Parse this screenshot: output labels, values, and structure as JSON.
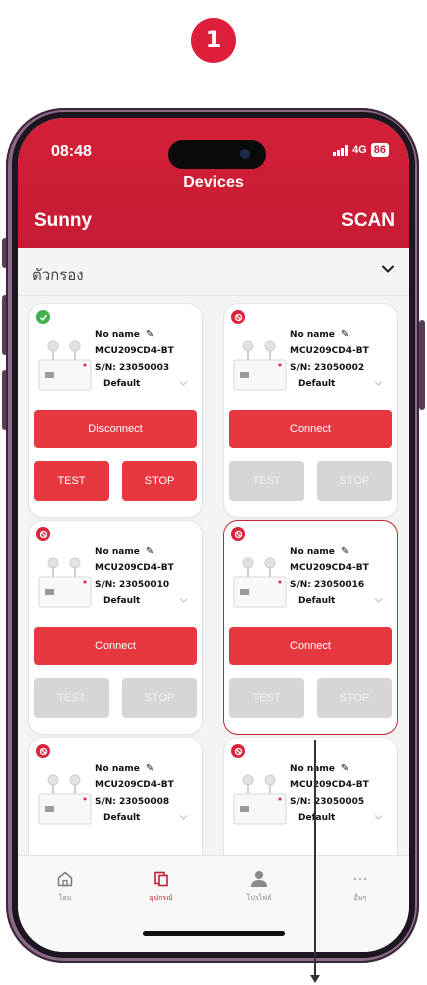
{
  "step_number": "1",
  "status_bar": {
    "time": "08:48",
    "network": "4G",
    "battery": "86"
  },
  "header": {
    "title": "Devices",
    "left_label": "Sunny",
    "right_action": "SCAN"
  },
  "filter": {
    "label": "ตัวกรอง"
  },
  "devices": [
    {
      "state": "connected",
      "name": "No name",
      "model": "MCU209CD4-BT",
      "serial": "S/N: 23050003",
      "mode": "Default",
      "action": "Disconnect",
      "test": "TEST",
      "stop": "STOP",
      "controls_enabled": true
    },
    {
      "state": "disconnected",
      "name": "No name",
      "model": "MCU209CD4-BT",
      "serial": "S/N: 23050002",
      "mode": "Default",
      "action": "Connect",
      "test": "TEST",
      "stop": "STOP",
      "controls_enabled": false
    },
    {
      "state": "disconnected",
      "name": "No name",
      "model": "MCU209CD4-BT",
      "serial": "S/N: 23050010",
      "mode": "Default",
      "action": "Connect",
      "test": "TEST",
      "stop": "STOP",
      "controls_enabled": false
    },
    {
      "state": "disconnected",
      "name": "No name",
      "model": "MCU209CD4-BT",
      "serial": "S/N: 23050016",
      "mode": "Default",
      "action": "Connect",
      "test": "TEST",
      "stop": "STOP",
      "controls_enabled": false,
      "highlighted": true
    },
    {
      "state": "disconnected",
      "name": "No name",
      "model": "MCU209CD4-BT",
      "serial": "S/N: 23050008",
      "mode": "Default"
    },
    {
      "state": "disconnected",
      "name": "No name",
      "model": "MCU209CD4-BT",
      "serial": "S/N: 23050005",
      "mode": "Default"
    }
  ],
  "tabbar": [
    {
      "label": "โฮม",
      "icon": "home-icon",
      "active": false
    },
    {
      "label": "อุปกรณ์",
      "icon": "devices-icon",
      "active": true
    },
    {
      "label": "โปรไฟล์",
      "icon": "profile-icon",
      "active": false
    },
    {
      "label": "อื่นๆ",
      "icon": "more-icon",
      "active": false
    }
  ],
  "colors": {
    "brand": "#c71b33",
    "button": "#e8383f",
    "connected": "#3fb14e",
    "disabled": "#d6d6d6"
  }
}
